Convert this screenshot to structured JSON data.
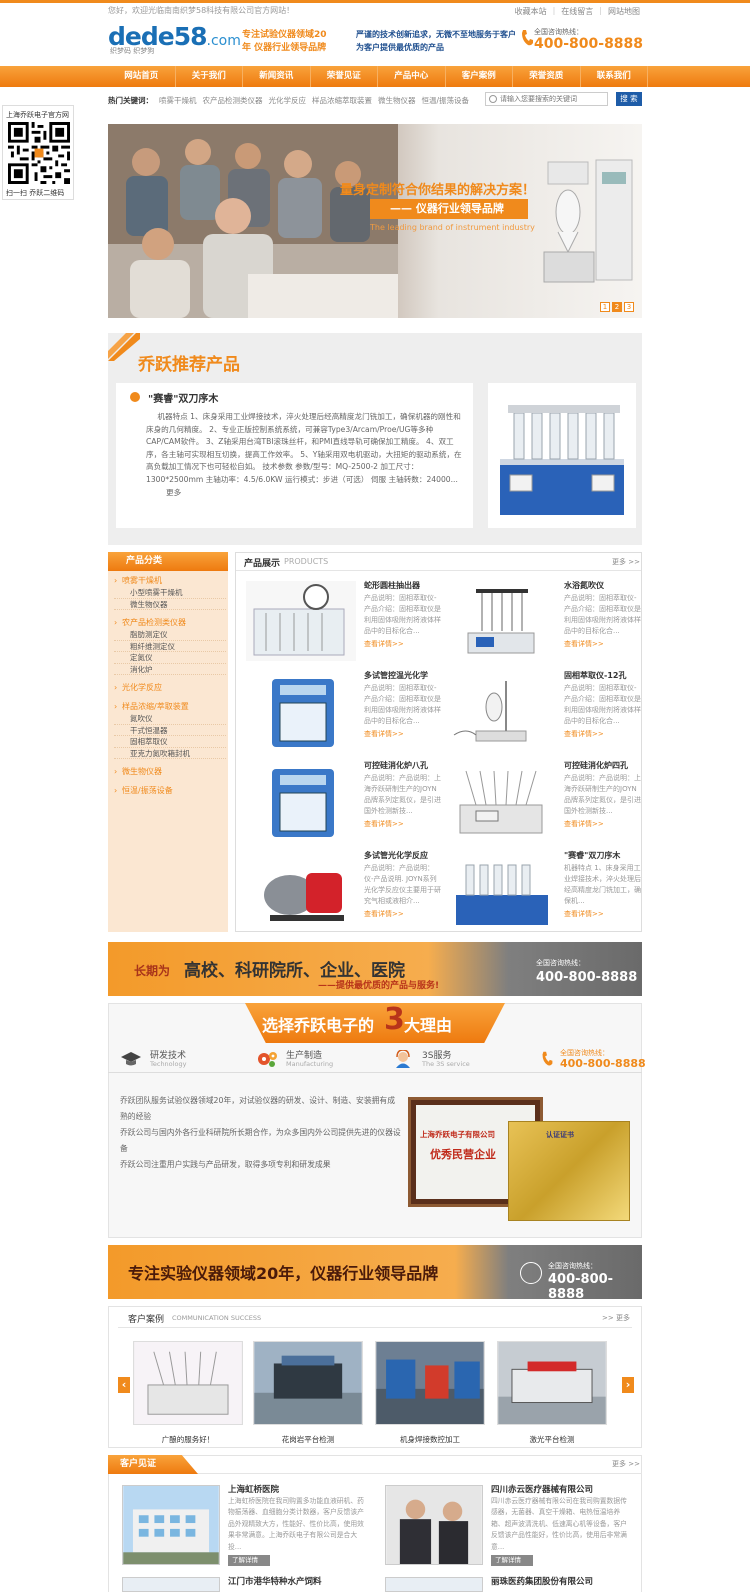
{
  "header": {
    "welcome": "您好，欢迎光临南南织梦58科技有限公司官方网站！",
    "links": [
      "收藏本站",
      "在线留言",
      "网站地图"
    ],
    "logo_text": "dede58",
    "logo_dot": ".com",
    "logo_sub": "织梦码    织梦狗",
    "slogan_left": "专注试验仪器领域20年 仪器行业领导品牌",
    "slogan_right": "严谨的技术创新追求，无微不至地服务于客户 为客户提供最优质的产品",
    "phone_label": "全国咨询热线：",
    "phone": "400-800-8888"
  },
  "nav": [
    "网站首页",
    "关于我们",
    "新闻资讯",
    "荣誉见证",
    "产品中心",
    "客户案例",
    "荣誉资质",
    "联系我们"
  ],
  "hot": {
    "label": "热门关键词：",
    "keywords": [
      "喷雾干燥机",
      "农产品检测类仪器",
      "光化学反应",
      "样品浓缩萃取装置",
      "微生物仪器",
      "恒温/振荡设备"
    ],
    "search_placeholder": "请输入您要搜索的关键词",
    "search_btn": "搜 索"
  },
  "qr": {
    "title": "上海乔跃电子官方网",
    "caption": "扫一扫   乔跃二维码"
  },
  "banner": {
    "headline": "量身定制符合你结果的解决方案！",
    "tag": "—— 仪器行业领导品牌",
    "en": "The leading brand of instrument industry",
    "pages": [
      "1",
      "2",
      "3"
    ]
  },
  "recommend": {
    "tag": "乔跃推荐",
    "title": "乔跃推荐产品",
    "name": "\"赛睿\"双刀序木",
    "desc": "机器特点  1、床身采用工业焊接技术，淬火处理后经高精度龙门铣加工，确保机器的刚性和床身的几何精度。    2、专业正版控制系统系统，可兼容Type3/Arcam/Proe/UG等多种CAP/CAM软件。   3、Z轴采用台湾TBI滚珠丝杆，和PMI直线导轨可确保加工精度。   4、双工序，各主轴可实现相互切换，提高工作效率。    5、Y轴采用双电机驱动，大扭矩的驱动系统，在高负载加工情况下也可轻松自如。    技术参数   参数/型号：MQ-2500-2 加工尺寸：1300*2500mm 主轴功率：4.5/6.0KW 运行模式：步进（可选）   伺服 主轴转数：24000...",
    "more": "更多"
  },
  "sidebar": {
    "title": "产品分类",
    "groups": [
      {
        "cat": "喷雾干燥机",
        "items": [
          "小型喷雾干燥机",
          "微生物仪器"
        ]
      },
      {
        "cat": "农产品检测类仪器",
        "items": [
          "脂肪测定仪",
          "粗纤维测定仪",
          "定氮仪",
          "消化炉"
        ]
      },
      {
        "cat": "光化学反应",
        "items": []
      },
      {
        "cat": "样品浓缩/萃取装置",
        "items": [
          "氮吹仪",
          "干式恒温器",
          "固相萃取仪",
          "亚克力氮吹箱封机"
        ]
      },
      {
        "cat": "微生物仪器",
        "items": []
      },
      {
        "cat": "恒温/振荡设备",
        "items": []
      }
    ]
  },
  "products": {
    "title": "产品展示",
    "title_en": "PRODUCTS",
    "more": "更多 >>",
    "items": [
      {
        "name": "蛇形圆柱抽出器",
        "desc": "产品说明：固相萃取仪-产品介绍：固相萃取仪是利用固体吸附剂将液体样品中的目标化合...",
        "link": "查看详情>>"
      },
      {
        "name": "水浴氮吹仪",
        "desc": "产品说明：固相萃取仪-产品介绍：固相萃取仪是利用固体吸附剂将液体样品中的目标化合...",
        "link": "查看详情>>"
      },
      {
        "name": "多试管控温光化学",
        "desc": "产品说明：固相萃取仪-产品介绍：固相萃取仪是利用固体吸附剂将液体样品中的目标化合...",
        "link": "查看详情>>"
      },
      {
        "name": "固相萃取仪-12孔",
        "desc": "产品说明：固相萃取仪-产品介绍：固相萃取仪是利用固体吸附剂将液体样品中的目标化合...",
        "link": "查看详情>>"
      },
      {
        "name": "可控硅消化炉八孔",
        "desc": "产品说明：产品说明：上海乔跃研制生产的JOYN品牌系列定氮仪，是引进国外检测新技...",
        "link": "查看详情>>"
      },
      {
        "name": "可控硅消化炉四孔",
        "desc": "产品说明：产品说明：上海乔跃研制生产的JOYN品牌系列定氮仪，是引进国外检测新技...",
        "link": "查看详情>>"
      },
      {
        "name": "多试管光化学反应",
        "desc": "产品说明：产品说明：仪-产品说明. JOYN系列光化学反应仪主要用于研究气相或液相介...",
        "link": "查看详情>>"
      },
      {
        "name": "\"赛睿\"双刀序木",
        "desc": "机器特点 1、床身采用工业焊接技术，淬火处理后经高精度龙门铣加工，确保机...",
        "link": "查看详情>>"
      }
    ]
  },
  "bar1": {
    "lead": "长期为",
    "main": "高校、科研院所、企业、医院",
    "sub": "——提供最优质的产品与服务!",
    "label": "全国咨询热线：",
    "phone": "400-800-8888"
  },
  "why": {
    "title": "选择乔跃电子的",
    "num": "3",
    "suffix": "大理由",
    "features": [
      {
        "name": "研发技术",
        "en": "Technology"
      },
      {
        "name": "生产制造",
        "en": "Manufacturing"
      },
      {
        "name": "3S服务",
        "en": "The 3S service"
      }
    ],
    "hot_label": "全国咨询热线：",
    "hot_phone": "400-800-8888",
    "text": "乔跃团队服务试验仪器领域20年，对试验仪器的研发、设计、制造、安装拥有成熟的经验\n乔跃公司与国内外各行业科研院所长期合作，为众多国内外公司提供先进的仪器设备\n乔跃公司注重用户实践与产品研发，取得多项专利和研发成果",
    "cert1_org": "上海乔跃电子有限公司",
    "cert1_title": "优秀民营企业",
    "cert2_title": "认证证书"
  },
  "bar2": {
    "text": "专注实验仪器领域20年，仪器行业领导品牌",
    "label": "全国咨询热线：",
    "phone": "400-800-8888"
  },
  "cases": {
    "title": "客户案例",
    "title_en": "COMMUNICATION SUCCESS",
    "more": ">> 更多",
    "items": [
      "广酿的服务好！",
      "花岗岩平台检测",
      "机身焊接数控加工",
      "激光平台检测"
    ]
  },
  "honor": {
    "title": "客户见证",
    "more": "更多 >>",
    "items": [
      {
        "name": "上海虹桥医院",
        "desc": "上海虹桥医院在我司购置多功能血液研机、药物振荡器、血细胞分类计数器，客户反馈该产品外观精致大方，性能好、性价比高，使用效果非常满意。上海乔跃电子有限公司是合大投...",
        "btn": "了解详情"
      },
      {
        "name": "四川赤云医疗器械有限公司",
        "desc": "四川赤云医疗器械有限公司在我司购置数据传感器，无菌器、真空干燥箱、电热恒温培养箱、超声波清洗机、低速离心机等设备，客户反馈该产品性能好，性价比高，使用后非常满意...",
        "btn": "了解详情"
      },
      {
        "name": "江门市港华特种水产饲料",
        "desc": "",
        "btn": ""
      },
      {
        "name": "丽珠医药集团股份有限公司",
        "desc": "",
        "btn": ""
      }
    ]
  }
}
